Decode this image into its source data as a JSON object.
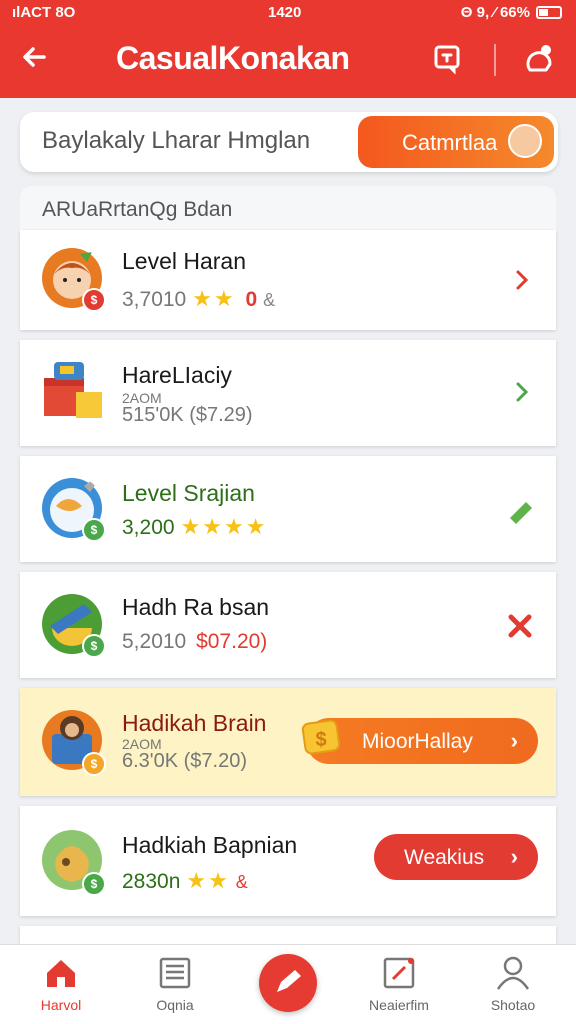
{
  "status": {
    "left": "ılACT 8O",
    "time": "1420",
    "right": "Θ 9, ⁄ 66%"
  },
  "header": {
    "title": "CasualKonakan",
    "accent": "#e8382f"
  },
  "search": {
    "placeholder": "Baylakaly Lharar Hmglan",
    "button_label": "Catmrtlaa"
  },
  "section": {
    "title": "ARUaRrtanQg Bdan"
  },
  "items": [
    {
      "name": "Level Haran",
      "meta": "3,7010",
      "rating_value": "0",
      "stars": "★★",
      "action": "chevron-right-icon",
      "action_color": "#e23b32"
    },
    {
      "name": "HareLIaciy",
      "small": "2AOM",
      "meta": "515'0K ($7.29)",
      "action": "chevron-right-icon",
      "action_color": "#4aa84a"
    },
    {
      "name": "Level Srajian",
      "meta": "3,200",
      "stars": "★★★★",
      "action": "check-icon",
      "action_color": "#4aa84a",
      "name_color": "#2d6e18"
    },
    {
      "name": "Hadh Ra bsan",
      "meta": "5,2010",
      "price": "$07.20)",
      "action": "close-icon",
      "action_color": "#e23b32"
    },
    {
      "name": "Hadikah Brain",
      "small": "2AOM",
      "meta": "6.3'0K ($7.20)",
      "button_label": "MioorHallay",
      "name_color": "#8b1a10"
    },
    {
      "name": "Hadkiah Bapnian",
      "meta": "2830n",
      "stars": "★★",
      "button_label": "Weakius",
      "name_color": "#1a1a1a"
    }
  ],
  "nav": [
    {
      "label": "Harvol",
      "icon": "home-icon",
      "active": true
    },
    {
      "label": "Oqnia",
      "icon": "list-icon",
      "active": false
    },
    {
      "label": "",
      "icon": "edit-icon",
      "active": false
    },
    {
      "label": "Neaierfim",
      "icon": "note-icon",
      "active": false
    },
    {
      "label": "Shotao",
      "icon": "profile-icon",
      "active": false
    }
  ]
}
